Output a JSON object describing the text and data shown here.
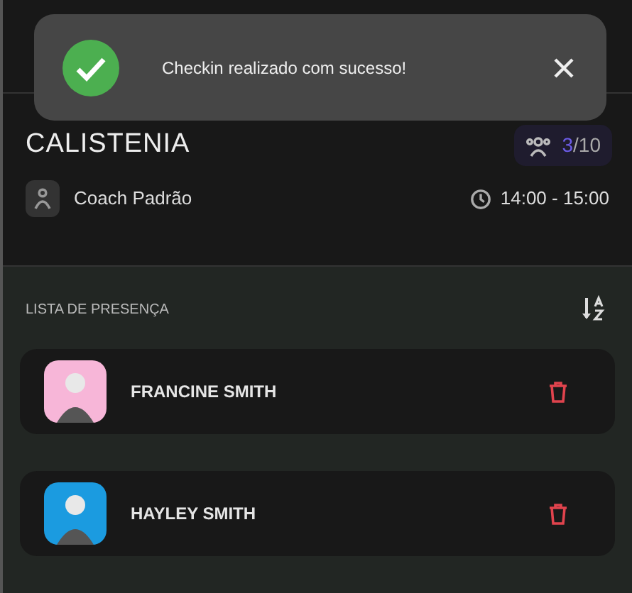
{
  "toast": {
    "message": "Checkin realizado com sucesso!"
  },
  "class": {
    "title": "CALISTENIA",
    "attendance": {
      "count": "3",
      "capacity": "/10"
    },
    "coach": "Coach Padrão",
    "time": "14:00 - 15:00"
  },
  "attendance_list": {
    "title": "LISTA DE PRESENÇA",
    "people": [
      {
        "name": "FRANCINE SMITH"
      },
      {
        "name": "HAYLEY SMITH"
      }
    ]
  }
}
